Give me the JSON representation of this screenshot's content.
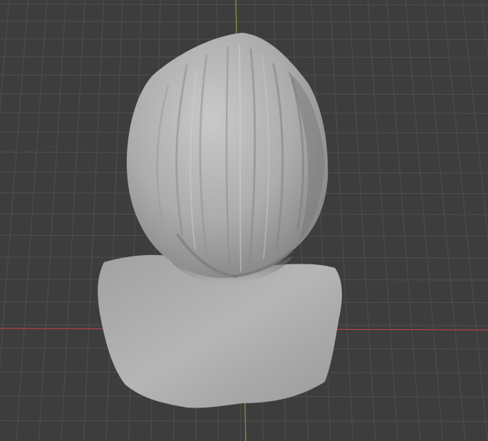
{
  "viewport": {
    "background_color": "#3d3d3d",
    "grid_color": "#4f4f4f",
    "x_axis_color": "#b3414b",
    "y_axis_color": "#7ea13d",
    "mesh_color": "#a6a6a6"
  },
  "scene": {
    "object": "sculpted-bust-back-view",
    "shading": "solid-matcap-grey"
  }
}
